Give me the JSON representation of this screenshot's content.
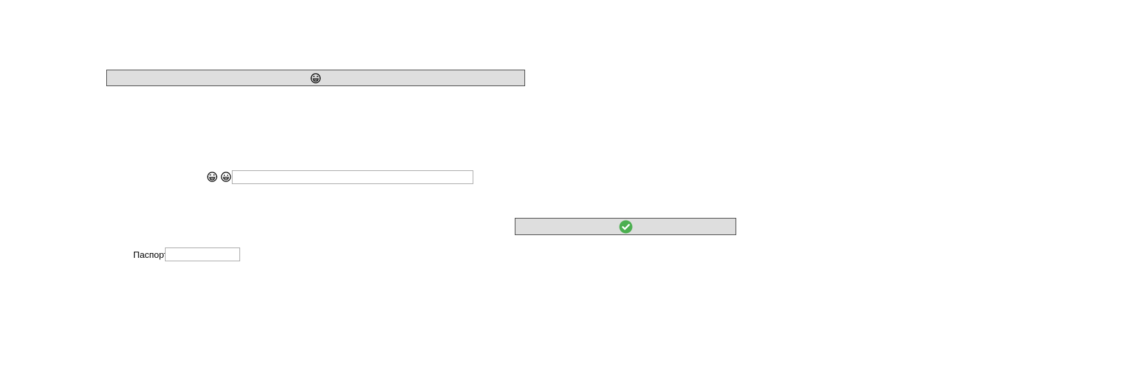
{
  "top_button": {
    "icon": "laughing-face-icon"
  },
  "emoji_row": {
    "icons": [
      "laughing-face-icon",
      "grinning-face-icon"
    ],
    "input_value": ""
  },
  "ok_button": {
    "icon": "green-check-circle-icon",
    "accent_color": "#4caf50"
  },
  "passport": {
    "label": "Паспорт",
    "input_value": ""
  }
}
